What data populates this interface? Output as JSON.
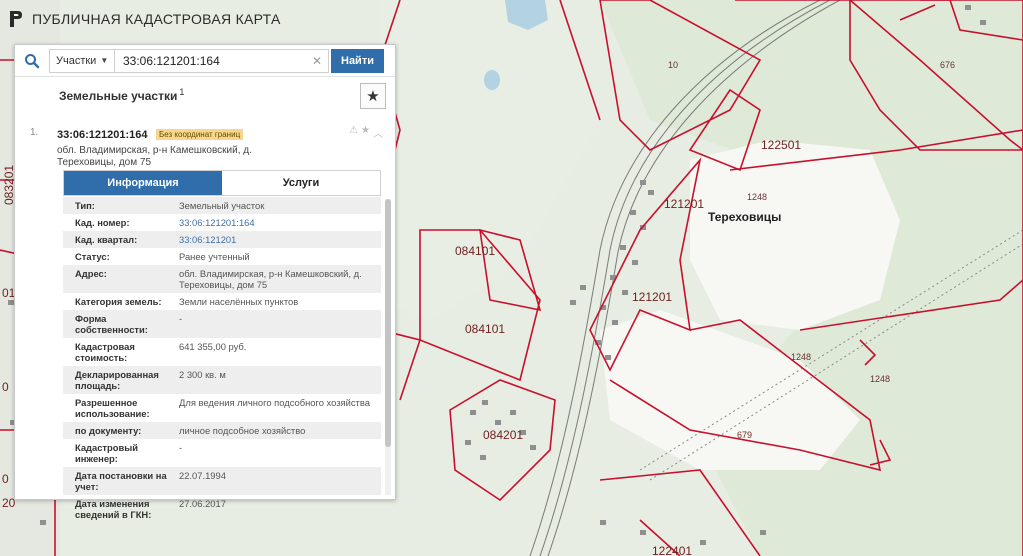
{
  "app": {
    "title": "ПУБЛИЧНАЯ КАДАСТРОВАЯ КАРТА"
  },
  "search": {
    "type_label": "Участки",
    "query": "33:06:121201:164",
    "find_label": "Найти"
  },
  "panel": {
    "section_title": "Земельные участки",
    "section_count": "1"
  },
  "result": {
    "number": "1.",
    "cad_number": "33:06:121201:164",
    "badge": "Без координат границ",
    "address": "обл. Владимирская, р-н Камешковский, д. Тереховицы, дом 75"
  },
  "tabs": [
    {
      "label": "Информация",
      "active": true
    },
    {
      "label": "Услуги",
      "active": false
    }
  ],
  "info": [
    {
      "key": "Тип:",
      "value": "Земельный участок"
    },
    {
      "key": "Кад. номер:",
      "value": "33:06:121201:164"
    },
    {
      "key": "Кад. квартал:",
      "value": "33:06:121201"
    },
    {
      "key": "Статус:",
      "value": "Ранее учтенный"
    },
    {
      "key": "Адрес:",
      "value": "обл. Владимирская, р-н Камешковский, д. Тереховицы, дом 75"
    },
    {
      "key": "Категория земель:",
      "value": "Земли населённых пунктов"
    },
    {
      "key": "Форма собственности:",
      "value": "-"
    },
    {
      "key": "Кадастровая стоимость:",
      "value": "641 355,00 руб."
    },
    {
      "key": "Декларированная площадь:",
      "value": "2 300 кв. м"
    },
    {
      "key": "Разрешенное использование:",
      "value": "Для ведения личного подсобного хозяйства"
    },
    {
      "key": "по документу:",
      "value": "личное подсобное хозяйство"
    },
    {
      "key": "Кадастровый инженер:",
      "value": "-"
    },
    {
      "key": "Дата постановки на учет:",
      "value": "22.07.1994"
    },
    {
      "key": "Дата изменения сведений в ГКН:",
      "value": "27.06.2017"
    }
  ],
  "map": {
    "labels": [
      "121201",
      "121201",
      "122501",
      "084101",
      "084101",
      "084201",
      "122401",
      "083201"
    ],
    "small_labels": [
      "10",
      "676",
      "1248",
      "1248",
      "1248",
      "679",
      "01"
    ],
    "place_name": "Тереховицы",
    "partial_labels": [
      "01",
      "0",
      "0",
      "20"
    ]
  },
  "colors": {
    "accent": "#2f6eaa",
    "parcel_border": "#c8102e",
    "badge": "#f5d88e"
  }
}
